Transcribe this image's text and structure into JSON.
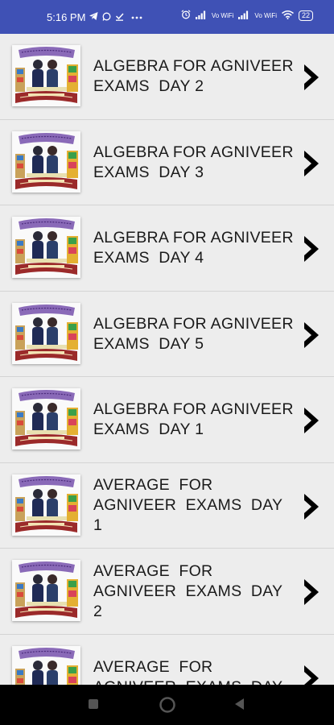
{
  "status_bar": {
    "time": "5:16 PM",
    "left_icons": [
      "telegram-icon",
      "whatsapp-icon",
      "download-done-icon",
      "more-dots-icon"
    ],
    "right_icons": [
      "alarm-icon",
      "signal-icon",
      "volte-wifi-icon",
      "signal-icon",
      "volte-wifi-icon",
      "wifi-icon",
      "battery-icon"
    ],
    "volte_label": "Vo WiFi",
    "battery_level": "22"
  },
  "list": {
    "items": [
      {
        "title": "ALGEBRA FOR AGNIVEER\nEXAMS  DAY 2"
      },
      {
        "title": "ALGEBRA FOR AGNIVEER\nEXAMS  DAY 3"
      },
      {
        "title": "ALGEBRA FOR AGNIVEER\nEXAMS  DAY 4"
      },
      {
        "title": "ALGEBRA FOR AGNIVEER\nEXAMS  DAY 5"
      },
      {
        "title": "ALGEBRA FOR AGNIVEER\nEXAMS  DAY 1"
      },
      {
        "title": "AVERAGE  FOR\nAGNIVEER  EXAMS  DAY\n1"
      },
      {
        "title": "AVERAGE  FOR\nAGNIVEER  EXAMS  DAY\n2"
      },
      {
        "title": "AVERAGE  FOR\nAGNIVEER  EXAMS  DAY"
      }
    ],
    "thumbnail_icon": "mathematics-logo-icon",
    "chevron_icon": "chevron-right-icon"
  },
  "nav_bar": {
    "icons": [
      "recents-square-icon",
      "home-circle-icon",
      "back-triangle-icon"
    ]
  },
  "colors": {
    "status_bar": "#3f51b5",
    "list_bg": "#ededed",
    "nav_bar": "#000000"
  }
}
